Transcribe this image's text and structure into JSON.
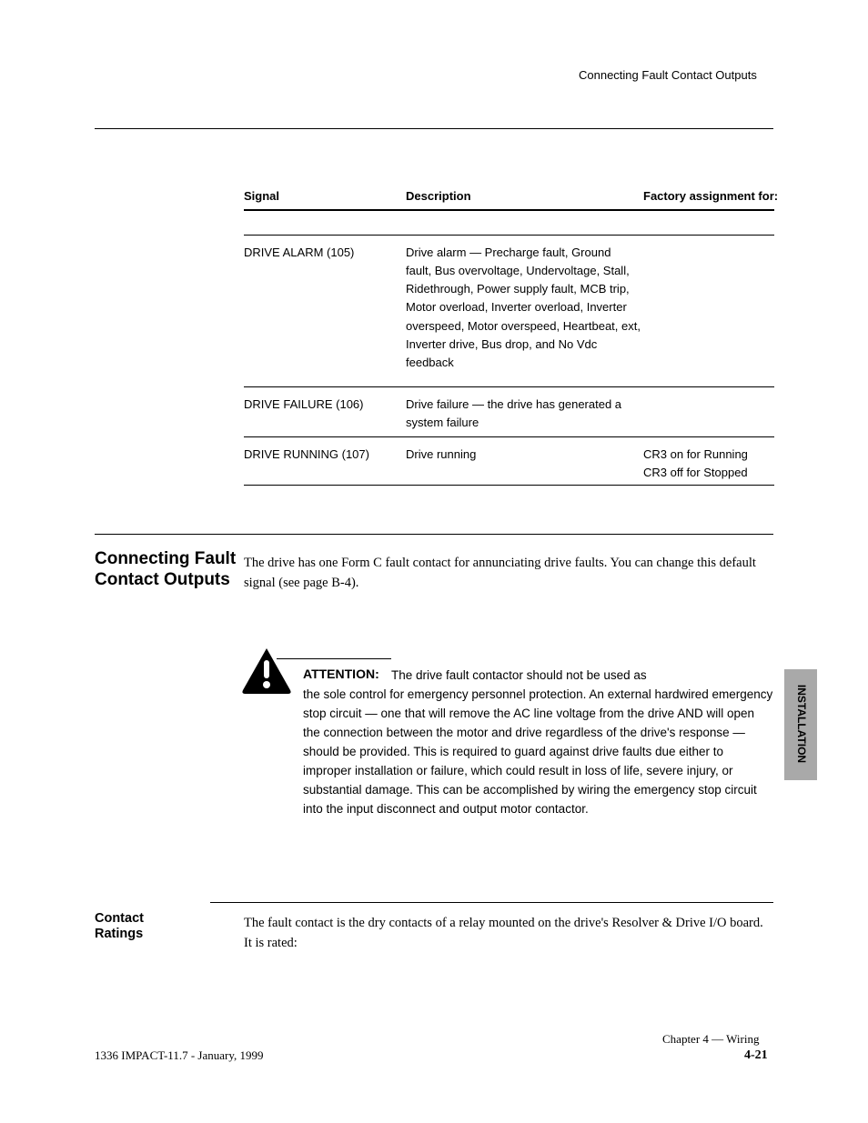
{
  "header": {
    "running_title": "Connecting Fault Contact Outputs"
  },
  "table": {
    "header": {
      "signal": "Signal",
      "desc": "Description",
      "asgn": "Factory assignment for:"
    },
    "rows": [
      {
        "signal": "DRIVE ALARM (105)",
        "desc": "Drive alarm — Precharge fault, Ground\nfault, Bus overvoltage, Undervoltage, Stall,\nRidethrough, Power supply fault, MCB trip,\nMotor overload, Inverter overload, Inverter\noverspeed, Motor overspeed, Heartbeat, ext,\nInverter drive, Bus drop, and No Vdc\nfeedback",
        "asgn": ""
      },
      {
        "signal": "DRIVE FAILURE (106)",
        "desc": "Drive failure — the drive has generated a\nsystem failure",
        "asgn": ""
      },
      {
        "signal": "DRIVE RUNNING (107)",
        "desc": "Drive running",
        "asgn": "CR3 on for Running\nCR3 off for Stopped"
      }
    ]
  },
  "section": {
    "heading": "Connecting Fault Contact Outputs",
    "p1": "The drive has one Form C fault contact for annunciating drive faults. You can change this default signal (see page B-4).",
    "warning_label": "ATTENTION:",
    "warning_body": "The drive fault contactor should not be used as\nthe sole control for emergency personnel protection. An\nexternal hardwired emergency stop circuit — one that will\nremove the AC line voltage from the drive AND will open the\nconnection between the motor and drive regardless of the\ndrive's response — should be provided. This is required to\nguard against drive faults due either to improper installation or\nfailure, which could result in loss of life, severe injury, or\nsubstantial damage. This can be accomplished by wiring the\nemergency stop circuit into the input disconnect and output\nmotor contactor.",
    "sub_label": "Contact\nRatings",
    "p2": "The fault contact is the dry contacts of a relay mounted on the drive's Resolver & Drive I/O board. It is rated:"
  },
  "side_tab": {
    "label": "INSTALLATION"
  },
  "footer": {
    "left": "1336 IMPACT-11.7 - January, 1999",
    "right_line1": "Chapter 4 — Wiring",
    "page_no": "4-21"
  }
}
